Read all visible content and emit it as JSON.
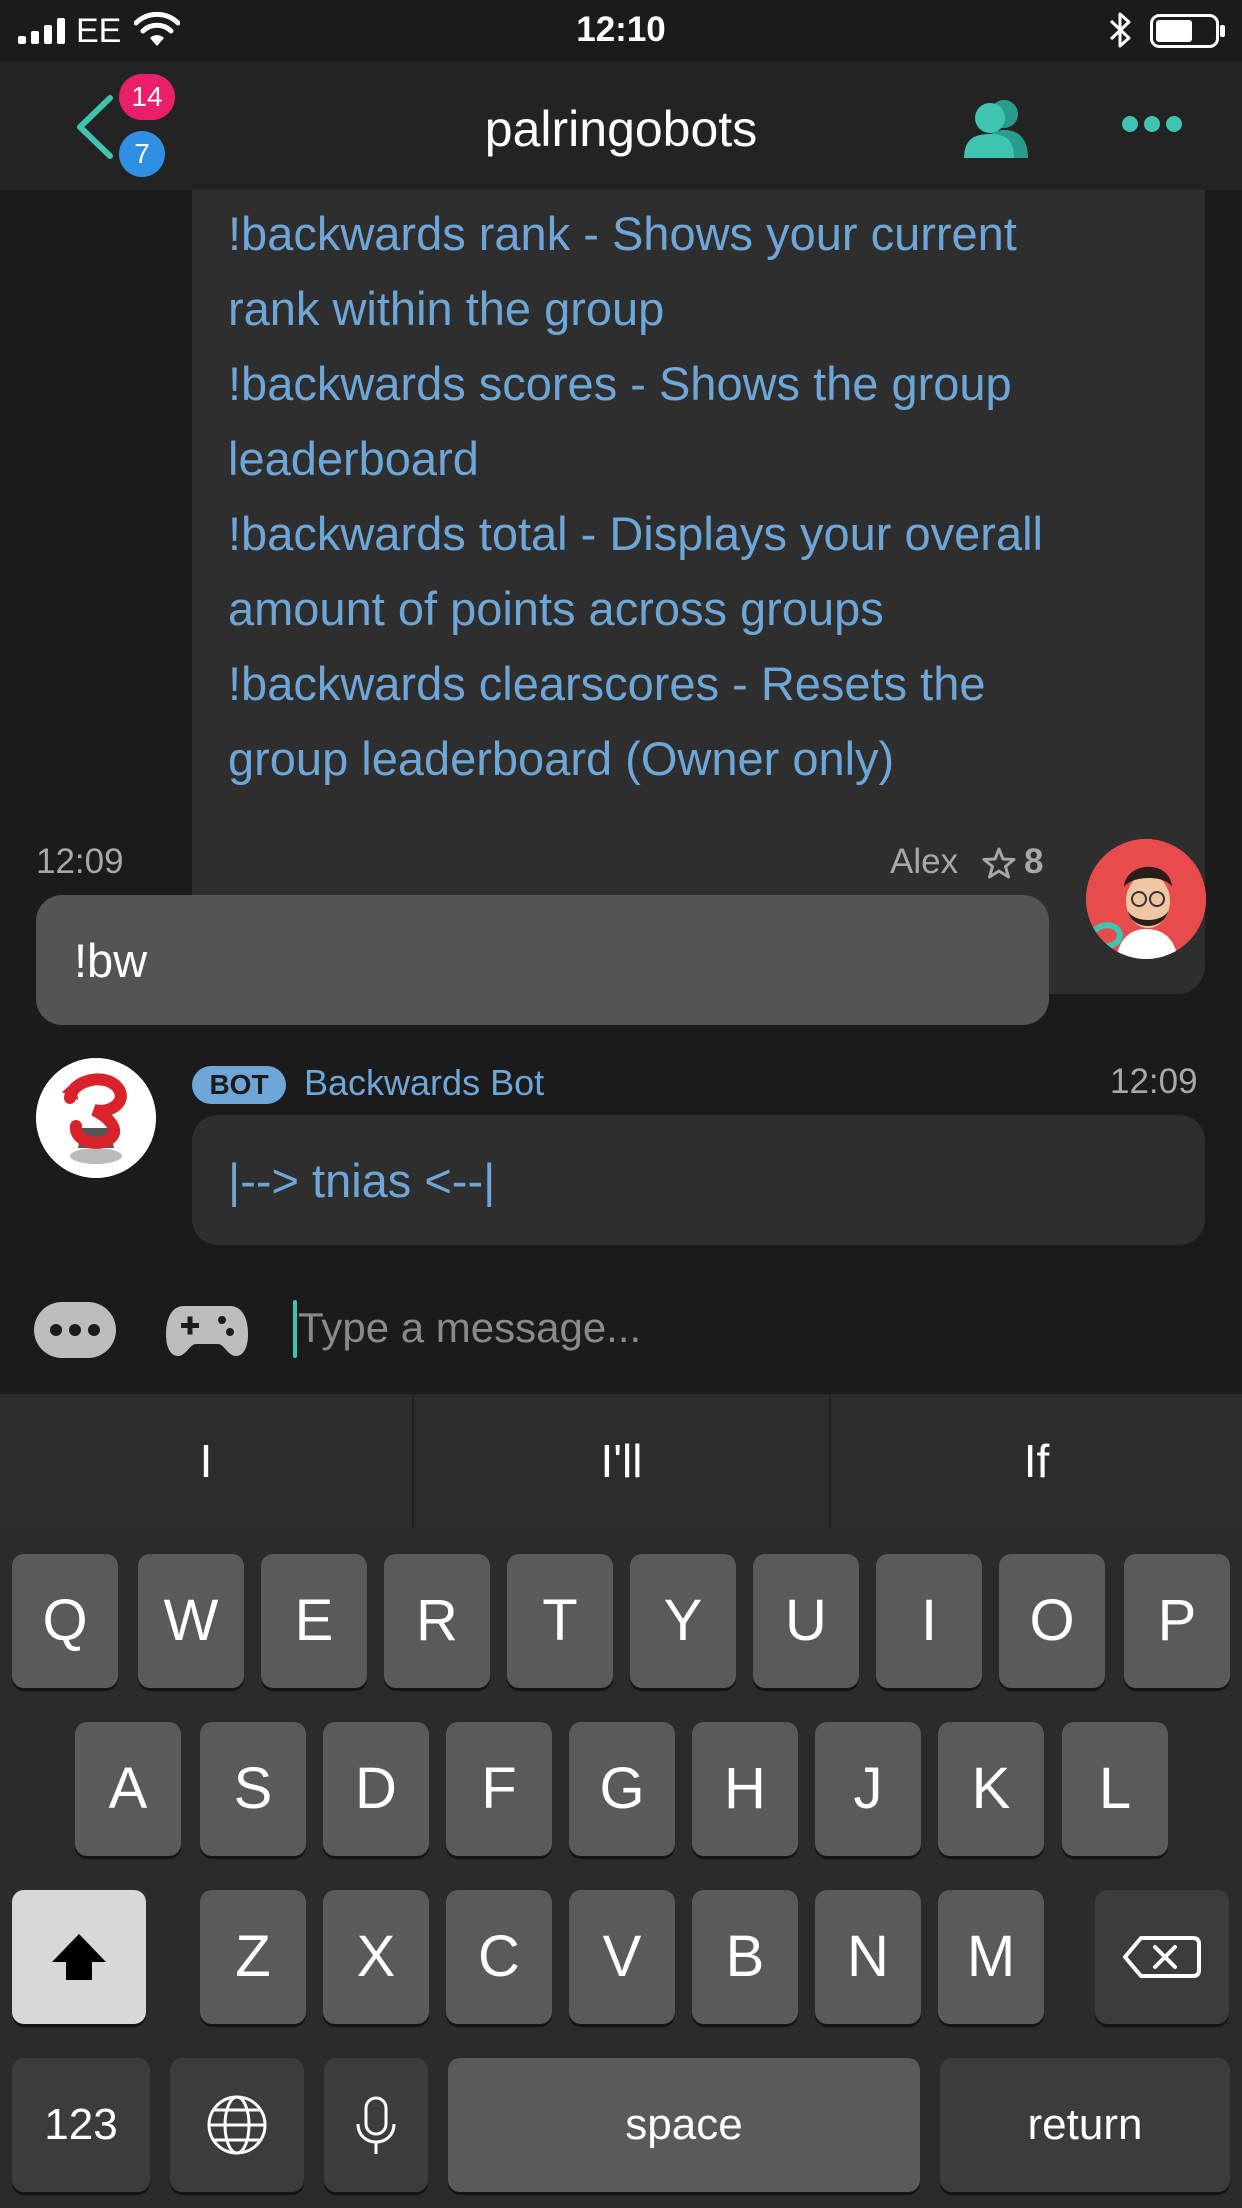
{
  "status_bar": {
    "carrier": "EE",
    "time": "12:10"
  },
  "nav": {
    "title": "palringobots",
    "badge_unread_pink": "14",
    "badge_unread_blue": "7",
    "accent_color": "#3ec4b1"
  },
  "messages": {
    "bot_long_lines": [
      "!backwards rank - Shows your current",
      "rank within the group",
      "!backwards scores - Shows the group",
      "leaderboard",
      "!backwards total - Displays your overall",
      "amount of points across groups",
      "!backwards clearscores - Resets the",
      "group leaderboard (Owner only)"
    ],
    "user_msg": {
      "time": "12:09",
      "author": "Alex",
      "score": "8",
      "text": "!bw"
    },
    "bot_msg": {
      "tag": "BOT",
      "name": "Backwards Bot",
      "time": "12:09",
      "text": "|--> tnias <--|"
    }
  },
  "compose": {
    "placeholder": "Type a message..."
  },
  "keyboard": {
    "suggestions": [
      "I",
      "I'll",
      "If"
    ],
    "row1": [
      "Q",
      "W",
      "E",
      "R",
      "T",
      "Y",
      "U",
      "I",
      "O",
      "P"
    ],
    "row2": [
      "A",
      "S",
      "D",
      "F",
      "G",
      "H",
      "J",
      "K",
      "L"
    ],
    "row3": [
      "Z",
      "X",
      "C",
      "V",
      "B",
      "N",
      "M"
    ],
    "numbers_label": "123",
    "space_label": "space",
    "return_label": "return"
  }
}
